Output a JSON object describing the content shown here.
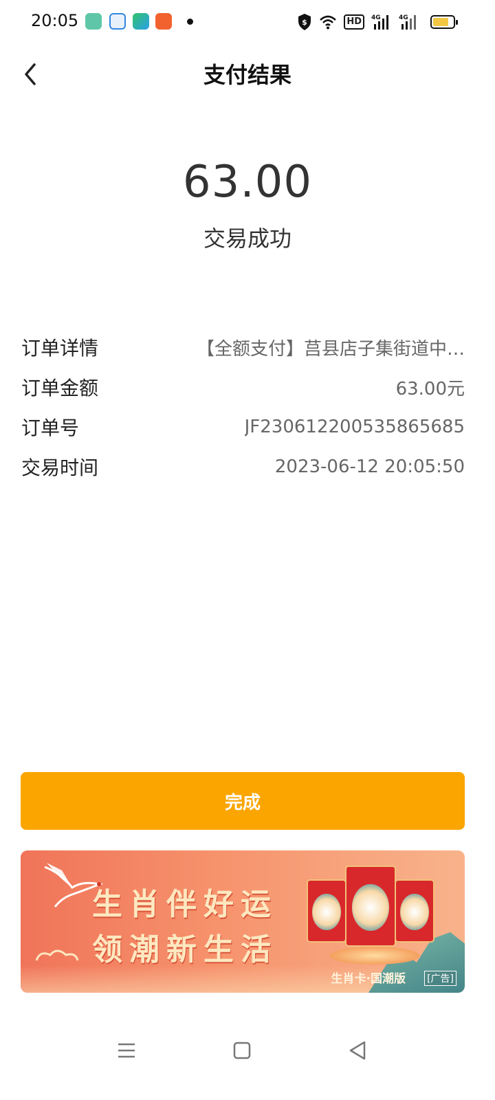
{
  "status_bar": {
    "time": "20:05",
    "hd_label": "HD",
    "network_1": "4G",
    "network_2": "4G",
    "app_icons": [
      "notes-app-icon",
      "qq-browser-icon",
      "video-app-icon",
      "kuaishou-icon"
    ],
    "battery_color": "#f2c744"
  },
  "header": {
    "title": "支付结果",
    "back_icon": "chevron-left-icon"
  },
  "result": {
    "amount": "63.00",
    "status": "交易成功"
  },
  "details": [
    {
      "label": "订单详情",
      "value": "【全额支付】莒县店子集街道中…"
    },
    {
      "label": "订单金额",
      "value": "63.00元"
    },
    {
      "label": "订单号",
      "value": "JF230612200535865685"
    },
    {
      "label": "交易时间",
      "value": "2023-06-12 20:05:50"
    }
  ],
  "done_button": {
    "label": "完成",
    "color": "#fba500"
  },
  "ad": {
    "line1": "生肖伴好运",
    "line2": "领潮新生活",
    "subtitle": "生肖卡·国潮版",
    "tag": "[广告]"
  },
  "nav_bar": {
    "icons": [
      "menu-icon",
      "home-square-icon",
      "back-triangle-icon"
    ]
  }
}
